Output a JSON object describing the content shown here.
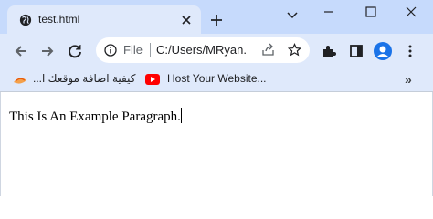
{
  "tab": {
    "title": "test.html",
    "favicon": "globe-icon"
  },
  "window_controls": [
    "minimize-icon",
    "maximize-icon",
    "close-icon"
  ],
  "toolbar": {
    "back": "back-arrow-icon",
    "forward": "forward-arrow-icon",
    "reload": "reload-icon"
  },
  "omnibox": {
    "info": "info-icon",
    "scheme_label": "File",
    "url": "C:/Users/MRyan...",
    "share": "share-icon",
    "star": "star-icon"
  },
  "actions": [
    "extensions-icon",
    "side-panel-icon",
    "profile-avatar",
    "menu-icon"
  ],
  "bookmarks": [
    {
      "label": "كيفية اضافة موقعك ا...",
      "icon": "bookmark-favicon"
    },
    {
      "label": "Host Your Website...",
      "icon": "youtube-icon"
    }
  ],
  "bookmarks_more": "»",
  "content": {
    "paragraph": "This Is An Example Paragraph."
  },
  "colors": {
    "titlebar": "#c6dafc",
    "toolbar": "#dfe9fb",
    "accent": "#1a73e8"
  }
}
